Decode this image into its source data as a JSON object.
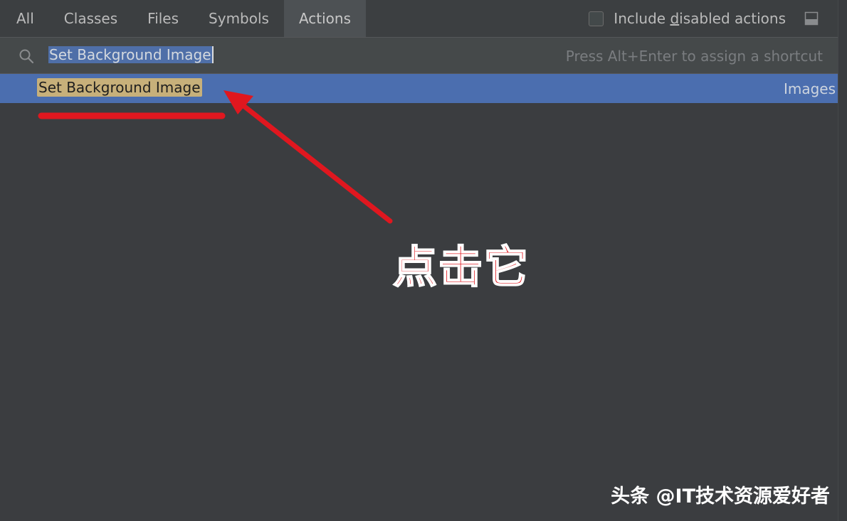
{
  "tabs": [
    {
      "label": "All"
    },
    {
      "label": "Classes"
    },
    {
      "label": "Files"
    },
    {
      "label": "Symbols"
    },
    {
      "label": "Actions",
      "active": true
    }
  ],
  "options": {
    "include_disabled_pre": "Include ",
    "include_disabled_mnemonic": "d",
    "include_disabled_post": "isabled actions",
    "include_disabled_checked": false
  },
  "search": {
    "value": "Set Background Image",
    "hint": "Press Alt+Enter to assign a shortcut"
  },
  "results": [
    {
      "name": "Set Background Image",
      "group": "Images",
      "selected": true
    }
  ],
  "annotation": {
    "label": "点击它",
    "color": "#e02027"
  },
  "watermark": "头条 @IT技术资源爱好者",
  "colors": {
    "background": "#3b3d40",
    "tabbar": "#3c3f41",
    "active_tab": "#4d5154",
    "selection": "#4b6eaf",
    "match_highlight": "#c7b07a"
  },
  "icons": {
    "search": "search-icon",
    "pin": "pin-window-icon"
  }
}
